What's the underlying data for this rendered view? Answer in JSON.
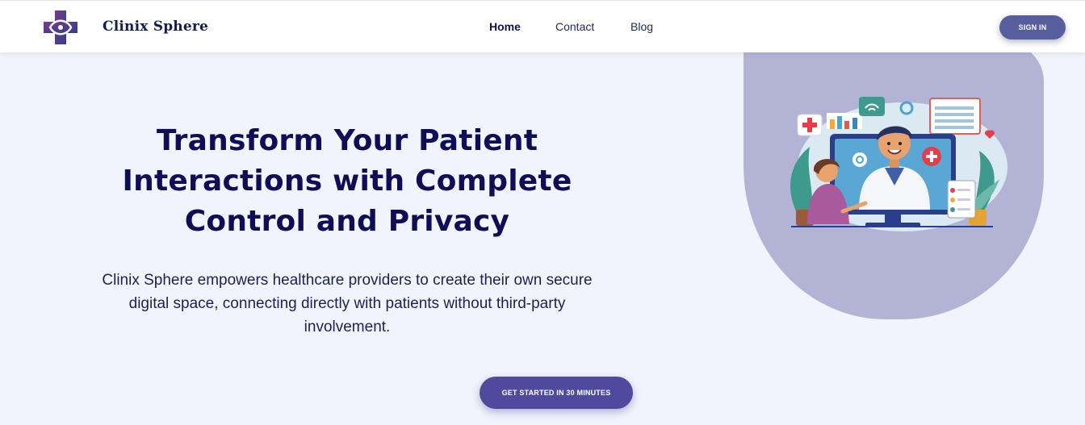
{
  "header": {
    "brand": "Clinix Sphere",
    "nav": {
      "home": "Home",
      "contact": "Contact",
      "blog": "Blog"
    },
    "signin_label": "SIGN IN"
  },
  "hero": {
    "title": "Transform Your Patient Interactions with Complete Control and Privacy",
    "subtitle": "Clinix Sphere empowers healthcare providers to create their own secure digital space, connecting directly with patients without third-party involvement.",
    "cta_label": "GET STARTED IN 30 MINUTES"
  },
  "colors": {
    "page_background": "#f1f4fb",
    "heading": "#0f0d56",
    "signin_button": "#565e9e",
    "cta_button": "#4e4b9e",
    "hero_blob": "#b3b3d6"
  },
  "icons": {
    "logo": "medical-cross-logo-icon",
    "illustration": "doctor-telemedicine-illustration"
  }
}
